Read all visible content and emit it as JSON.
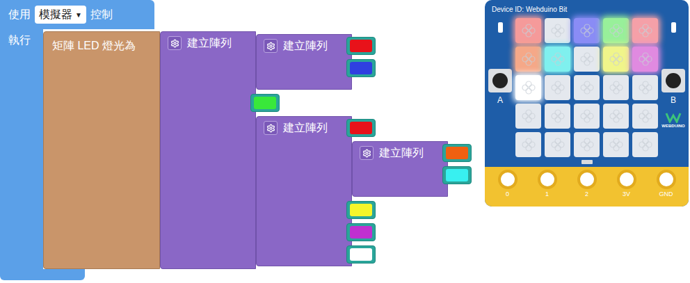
{
  "workspace": {
    "use_label": "使用",
    "device_dropdown": {
      "label": "模擬器",
      "arrow": "▼"
    },
    "control_label": "控制",
    "exec_label": "執行",
    "matrix_block": {
      "label": "矩陣 LED 燈光為",
      "value": {
        "kind": "array",
        "label": "建立陣列",
        "items": [
          {
            "kind": "array",
            "label": "建立陣列",
            "items": [
              {
                "kind": "color",
                "color": "#e8121a"
              },
              {
                "kind": "color",
                "color": "#2f3fe0"
              }
            ]
          },
          {
            "kind": "color",
            "color": "#39e83a"
          },
          {
            "kind": "array",
            "label": "建立陣列",
            "items": [
              {
                "kind": "color",
                "color": "#e8121a"
              },
              {
                "kind": "array",
                "label": "建立陣列",
                "items": [
                  {
                    "kind": "color",
                    "color": "#f06010"
                  },
                  {
                    "kind": "color",
                    "color": "#38f0f0"
                  }
                ]
              },
              {
                "kind": "color",
                "color": "#f5f52a"
              },
              {
                "kind": "color",
                "color": "#c030d0"
              },
              {
                "kind": "color",
                "color": "#ffffff"
              }
            ]
          }
        ]
      }
    }
  },
  "board": {
    "device_id": "Device ID: Webduino Bit",
    "button_a": "A",
    "button_b": "B",
    "logo_text": "WEBDUINO",
    "leds": [
      {
        "on": true,
        "color": "#f59a9a"
      },
      {
        "on": false,
        "color": "#e4e8ee"
      },
      {
        "on": true,
        "color": "#8a8cf5"
      },
      {
        "on": true,
        "color": "#98f09a"
      },
      {
        "on": true,
        "color": "#f5a0a8"
      },
      {
        "on": true,
        "color": "#f5a888"
      },
      {
        "on": true,
        "color": "#7ff0ee"
      },
      {
        "on": false,
        "color": "#e4e8ee"
      },
      {
        "on": true,
        "color": "#f0f58a"
      },
      {
        "on": true,
        "color": "#e08ae0"
      },
      {
        "on": true,
        "color": "#ffffff"
      },
      {
        "on": false,
        "color": "#e4e8ee"
      },
      {
        "on": false,
        "color": "#e4e8ee"
      },
      {
        "on": false,
        "color": "#e4e8ee"
      },
      {
        "on": false,
        "color": "#e4e8ee"
      },
      {
        "on": false,
        "color": "#e4e8ee"
      },
      {
        "on": false,
        "color": "#e4e8ee"
      },
      {
        "on": false,
        "color": "#e4e8ee"
      },
      {
        "on": false,
        "color": "#e4e8ee"
      },
      {
        "on": false,
        "color": "#e4e8ee"
      },
      {
        "on": false,
        "color": "#e4e8ee"
      },
      {
        "on": false,
        "color": "#e4e8ee"
      },
      {
        "on": false,
        "color": "#e4e8ee"
      },
      {
        "on": false,
        "color": "#e4e8ee"
      },
      {
        "on": false,
        "color": "#e4e8ee"
      }
    ],
    "pins": [
      "0",
      "1",
      "2",
      "3V",
      "GND"
    ]
  }
}
